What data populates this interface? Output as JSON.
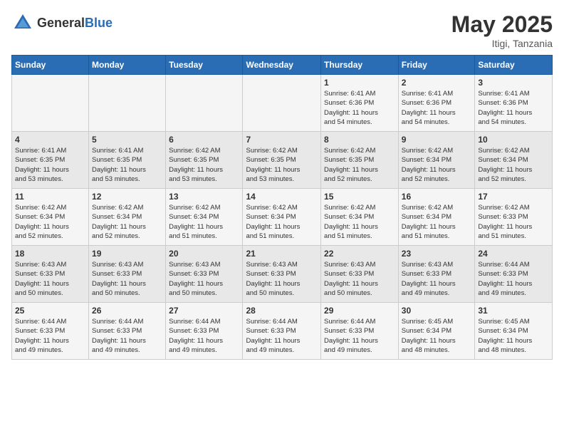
{
  "header": {
    "logo_general": "General",
    "logo_blue": "Blue",
    "month_year": "May 2025",
    "location": "Itigi, Tanzania"
  },
  "weekdays": [
    "Sunday",
    "Monday",
    "Tuesday",
    "Wednesday",
    "Thursday",
    "Friday",
    "Saturday"
  ],
  "weeks": [
    [
      {
        "day": "",
        "info": ""
      },
      {
        "day": "",
        "info": ""
      },
      {
        "day": "",
        "info": ""
      },
      {
        "day": "",
        "info": ""
      },
      {
        "day": "1",
        "info": "Sunrise: 6:41 AM\nSunset: 6:36 PM\nDaylight: 11 hours\nand 54 minutes."
      },
      {
        "day": "2",
        "info": "Sunrise: 6:41 AM\nSunset: 6:36 PM\nDaylight: 11 hours\nand 54 minutes."
      },
      {
        "day": "3",
        "info": "Sunrise: 6:41 AM\nSunset: 6:36 PM\nDaylight: 11 hours\nand 54 minutes."
      }
    ],
    [
      {
        "day": "4",
        "info": "Sunrise: 6:41 AM\nSunset: 6:35 PM\nDaylight: 11 hours\nand 53 minutes."
      },
      {
        "day": "5",
        "info": "Sunrise: 6:41 AM\nSunset: 6:35 PM\nDaylight: 11 hours\nand 53 minutes."
      },
      {
        "day": "6",
        "info": "Sunrise: 6:42 AM\nSunset: 6:35 PM\nDaylight: 11 hours\nand 53 minutes."
      },
      {
        "day": "7",
        "info": "Sunrise: 6:42 AM\nSunset: 6:35 PM\nDaylight: 11 hours\nand 53 minutes."
      },
      {
        "day": "8",
        "info": "Sunrise: 6:42 AM\nSunset: 6:35 PM\nDaylight: 11 hours\nand 52 minutes."
      },
      {
        "day": "9",
        "info": "Sunrise: 6:42 AM\nSunset: 6:34 PM\nDaylight: 11 hours\nand 52 minutes."
      },
      {
        "day": "10",
        "info": "Sunrise: 6:42 AM\nSunset: 6:34 PM\nDaylight: 11 hours\nand 52 minutes."
      }
    ],
    [
      {
        "day": "11",
        "info": "Sunrise: 6:42 AM\nSunset: 6:34 PM\nDaylight: 11 hours\nand 52 minutes."
      },
      {
        "day": "12",
        "info": "Sunrise: 6:42 AM\nSunset: 6:34 PM\nDaylight: 11 hours\nand 52 minutes."
      },
      {
        "day": "13",
        "info": "Sunrise: 6:42 AM\nSunset: 6:34 PM\nDaylight: 11 hours\nand 51 minutes."
      },
      {
        "day": "14",
        "info": "Sunrise: 6:42 AM\nSunset: 6:34 PM\nDaylight: 11 hours\nand 51 minutes."
      },
      {
        "day": "15",
        "info": "Sunrise: 6:42 AM\nSunset: 6:34 PM\nDaylight: 11 hours\nand 51 minutes."
      },
      {
        "day": "16",
        "info": "Sunrise: 6:42 AM\nSunset: 6:34 PM\nDaylight: 11 hours\nand 51 minutes."
      },
      {
        "day": "17",
        "info": "Sunrise: 6:42 AM\nSunset: 6:33 PM\nDaylight: 11 hours\nand 51 minutes."
      }
    ],
    [
      {
        "day": "18",
        "info": "Sunrise: 6:43 AM\nSunset: 6:33 PM\nDaylight: 11 hours\nand 50 minutes."
      },
      {
        "day": "19",
        "info": "Sunrise: 6:43 AM\nSunset: 6:33 PM\nDaylight: 11 hours\nand 50 minutes."
      },
      {
        "day": "20",
        "info": "Sunrise: 6:43 AM\nSunset: 6:33 PM\nDaylight: 11 hours\nand 50 minutes."
      },
      {
        "day": "21",
        "info": "Sunrise: 6:43 AM\nSunset: 6:33 PM\nDaylight: 11 hours\nand 50 minutes."
      },
      {
        "day": "22",
        "info": "Sunrise: 6:43 AM\nSunset: 6:33 PM\nDaylight: 11 hours\nand 50 minutes."
      },
      {
        "day": "23",
        "info": "Sunrise: 6:43 AM\nSunset: 6:33 PM\nDaylight: 11 hours\nand 49 minutes."
      },
      {
        "day": "24",
        "info": "Sunrise: 6:44 AM\nSunset: 6:33 PM\nDaylight: 11 hours\nand 49 minutes."
      }
    ],
    [
      {
        "day": "25",
        "info": "Sunrise: 6:44 AM\nSunset: 6:33 PM\nDaylight: 11 hours\nand 49 minutes."
      },
      {
        "day": "26",
        "info": "Sunrise: 6:44 AM\nSunset: 6:33 PM\nDaylight: 11 hours\nand 49 minutes."
      },
      {
        "day": "27",
        "info": "Sunrise: 6:44 AM\nSunset: 6:33 PM\nDaylight: 11 hours\nand 49 minutes."
      },
      {
        "day": "28",
        "info": "Sunrise: 6:44 AM\nSunset: 6:33 PM\nDaylight: 11 hours\nand 49 minutes."
      },
      {
        "day": "29",
        "info": "Sunrise: 6:44 AM\nSunset: 6:33 PM\nDaylight: 11 hours\nand 49 minutes."
      },
      {
        "day": "30",
        "info": "Sunrise: 6:45 AM\nSunset: 6:34 PM\nDaylight: 11 hours\nand 48 minutes."
      },
      {
        "day": "31",
        "info": "Sunrise: 6:45 AM\nSunset: 6:34 PM\nDaylight: 11 hours\nand 48 minutes."
      }
    ]
  ]
}
